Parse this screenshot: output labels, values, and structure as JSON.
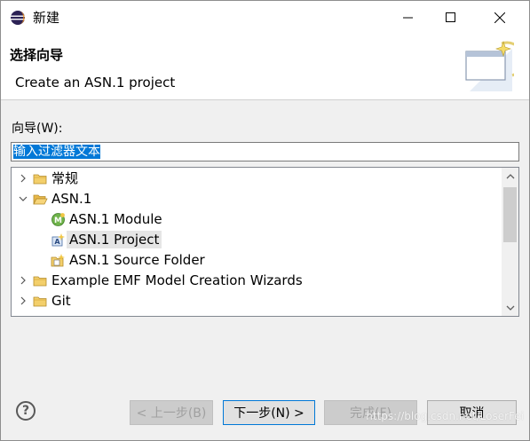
{
  "window": {
    "title": "新建"
  },
  "banner": {
    "title": "选择向导",
    "description": "Create an ASN.1 project"
  },
  "filter": {
    "label": "向导(W):",
    "value": "输入过滤器文本"
  },
  "tree": {
    "items": [
      {
        "label": "常规",
        "expanded": false,
        "level": 0,
        "icon": "folder-icon"
      },
      {
        "label": "ASN.1",
        "expanded": true,
        "level": 0,
        "icon": "folder-icon"
      },
      {
        "label": "ASN.1 Module",
        "level": 1,
        "icon": "asn-module-icon"
      },
      {
        "label": "ASN.1 Project",
        "level": 1,
        "icon": "asn-project-icon",
        "selected": true
      },
      {
        "label": "ASN.1 Source Folder",
        "level": 1,
        "icon": "asn-source-folder-icon"
      },
      {
        "label": "Example EMF Model Creation Wizards",
        "expanded": false,
        "level": 0,
        "icon": "folder-icon"
      },
      {
        "label": "Git",
        "expanded": false,
        "level": 0,
        "icon": "folder-icon"
      }
    ]
  },
  "buttons": {
    "back": "< 上一步(B)",
    "next": "下一步(N) >",
    "finish": "完成(F)",
    "cancel": "取消",
    "help": "?"
  },
  "watermark": "https://blog.csdn.net/LoserFei",
  "colors": {
    "accent": "#0078d7",
    "folder": "#e8b84a",
    "selection_bg": "#e5e5e5"
  }
}
